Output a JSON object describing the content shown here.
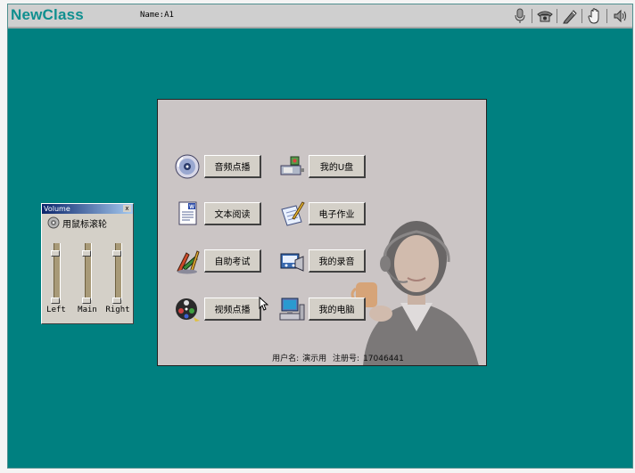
{
  "topbar": {
    "brand": "NewClass",
    "user_prefix": "Name:",
    "user_name": "A1",
    "tools": [
      {
        "icon": "microphone-icon"
      },
      {
        "icon": "phone-icon"
      },
      {
        "icon": "pen-icon"
      },
      {
        "icon": "hand-icon"
      },
      {
        "icon": "volume-icon"
      }
    ]
  },
  "menu": {
    "audio_on_demand": "音频点播",
    "text_reading": "文本阅读",
    "self_exam": "自助考试",
    "video_on_demand": "视频点播",
    "my_usb": "我的U盘",
    "homework": "电子作业",
    "my_recording": "我的录音",
    "my_computer": "我的电脑"
  },
  "footer": {
    "username_label": "用户名:",
    "username_value": "演示用",
    "reg_label": "注册号:",
    "reg_value": "17046441"
  },
  "volume": {
    "title": "Volume",
    "close": "x",
    "hint": "用鼠标滚轮",
    "channels": [
      {
        "label": "Left",
        "level": 0.8
      },
      {
        "label": "Main",
        "level": 0.8
      },
      {
        "label": "Right",
        "level": 0.8
      }
    ]
  }
}
